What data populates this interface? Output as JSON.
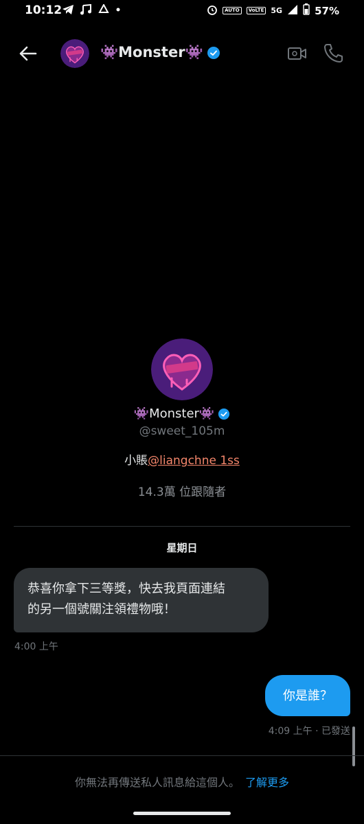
{
  "status_bar": {
    "time": "10:12",
    "icons_left": [
      "telegram-icon",
      "music-icon",
      "sync-icon",
      "dot-icon"
    ],
    "auto_label": "AUTO",
    "volte_label": "VoLTE",
    "network": "5G",
    "battery": "57%"
  },
  "header": {
    "name": "👾Monster👾",
    "icons": [
      "back-arrow-icon",
      "verified-icon",
      "video-icon",
      "phone-icon"
    ]
  },
  "profile": {
    "name": "👾Monster👾",
    "handle": "@sweet_105m",
    "bio_prefix": "小賬",
    "bio_mention": "@liangchne 1ss",
    "followers": "14.3萬 位跟隨者"
  },
  "conversation": {
    "day": "星期日",
    "messages": [
      {
        "direction": "in",
        "line1": "恭喜你拿下三等獎，快去我頁面連結",
        "line2": "的另一個號關注領禮物哦！",
        "time": "4:00 上午"
      },
      {
        "direction": "out",
        "text": "你是誰？",
        "meta": "4:09 上午 · 已發送"
      }
    ]
  },
  "footer": {
    "notice": "你無法再傳送私人訊息給這個人。",
    "learn_more": "了解更多"
  },
  "colors": {
    "background": "#000000",
    "accent": "#1d9bf0",
    "bubble_in": "#2f3336",
    "mention": "#f4866b",
    "avatar": "#4a1d7a"
  }
}
